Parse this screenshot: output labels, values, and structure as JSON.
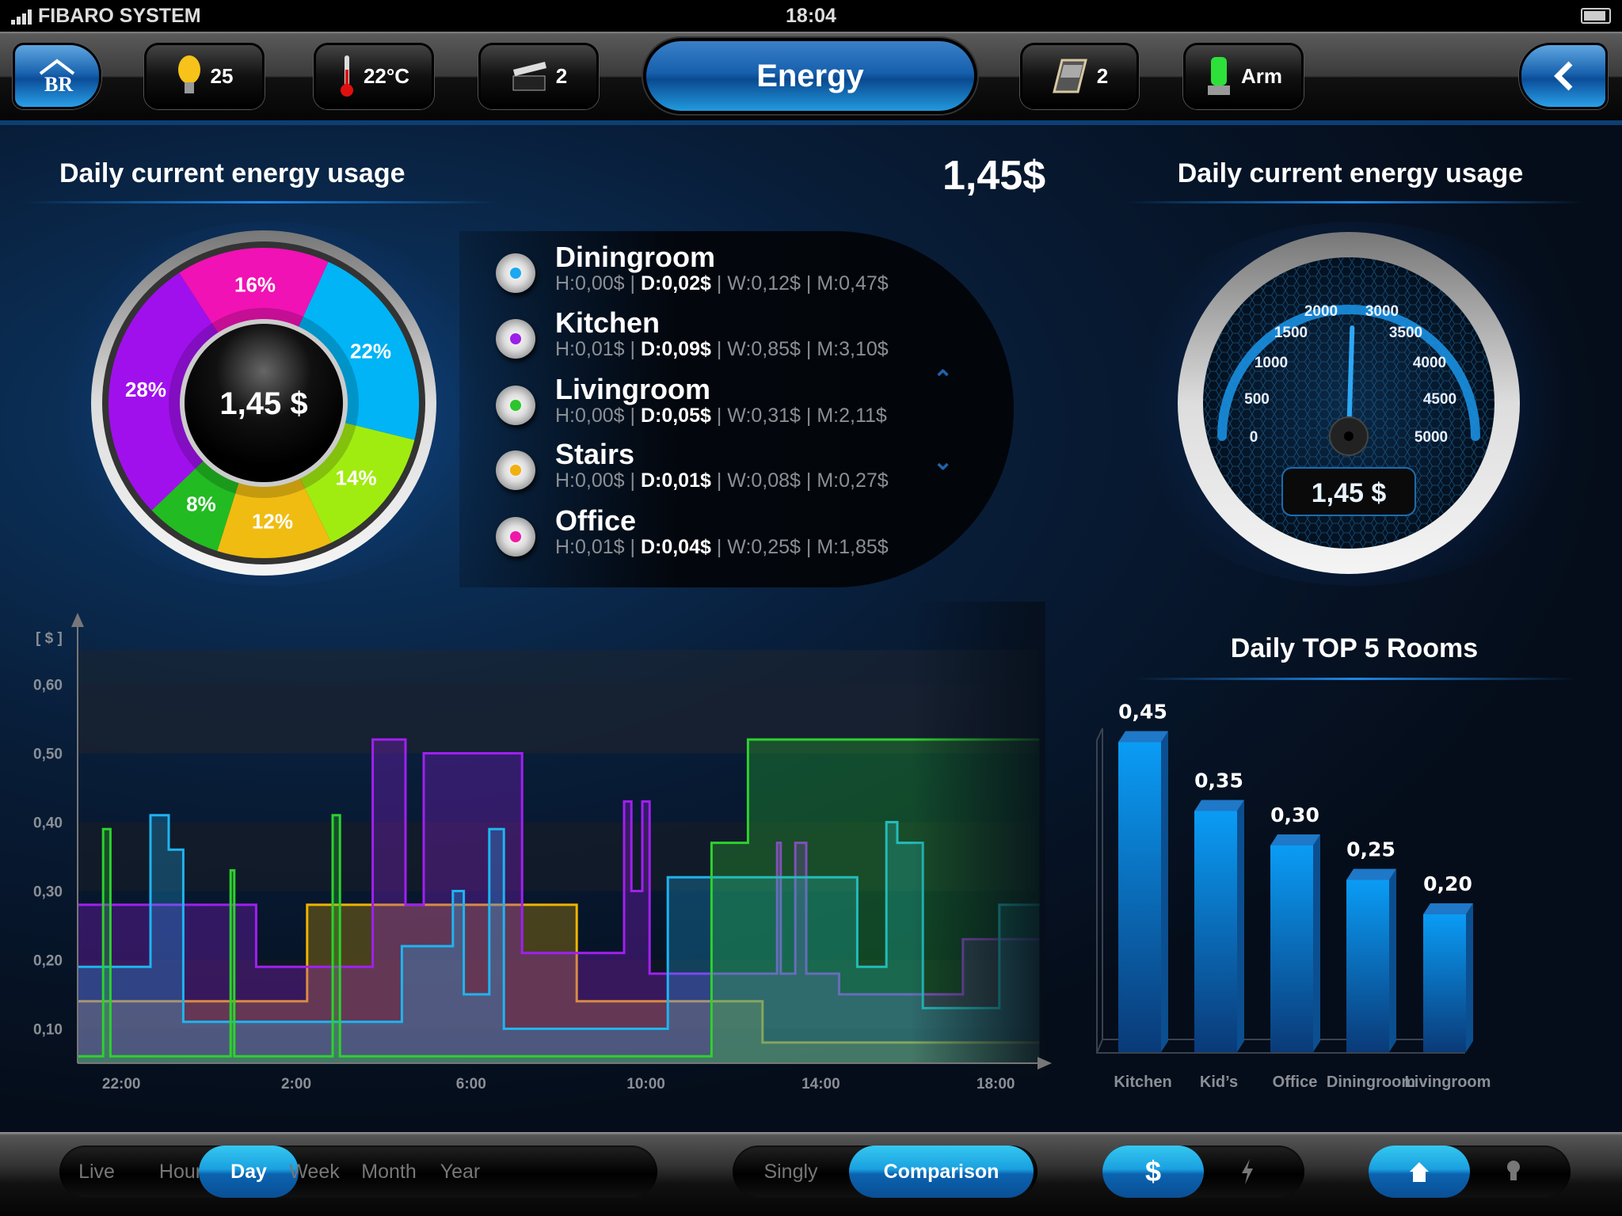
{
  "status_bar": {
    "carrier": "FIBARO SYSTEM",
    "time": "18:04",
    "battery_level": 0.9
  },
  "nav": {
    "home_icon": "home-br-icon",
    "lights": {
      "icon": "lightbulb-icon",
      "value": "25"
    },
    "temperature": {
      "icon": "thermometer-icon",
      "value": "22°C"
    },
    "scenes": {
      "icon": "clapperboard-icon",
      "value": "2"
    },
    "title": "Energy",
    "blinds": {
      "icon": "window-blind-icon",
      "value": "2"
    },
    "alarm": {
      "icon": "alarm-siren-icon",
      "value": "Arm"
    },
    "back_icon": "chevron-left-icon"
  },
  "left_panel": {
    "title": "Daily current energy usage",
    "total": "1,45$",
    "donut_center": "1,45 $"
  },
  "right_panel": {
    "title": "Daily current energy usage",
    "gauge_readout": "1,45 $"
  },
  "donut": {
    "slices": [
      {
        "label": "16%",
        "value": 16,
        "color": "#f012b4"
      },
      {
        "label": "22%",
        "value": 22,
        "color": "#00b4f5"
      },
      {
        "label": "14%",
        "value": 14,
        "color": "#a0ec10"
      },
      {
        "label": "12%",
        "value": 12,
        "color": "#f0bc12"
      },
      {
        "label": "8%",
        "value": 8,
        "color": "#22bb22"
      },
      {
        "label": "28%",
        "value": 28,
        "color": "#a010ec"
      }
    ]
  },
  "rooms": [
    {
      "name": "Diningroom",
      "color": "#1aa8f0",
      "h": "H:0,00$",
      "d": "D:0,02$",
      "w": "W:0,12$",
      "m": "M:0,47$"
    },
    {
      "name": "Kitchen",
      "color": "#9b20e8",
      "h": "H:0,01$",
      "d": "D:0,09$",
      "w": "W:0,85$",
      "m": "M:3,10$"
    },
    {
      "name": "Livingroom",
      "color": "#2cc52c",
      "h": "H:0,00$",
      "d": "D:0,05$",
      "w": "W:0,31$",
      "m": "M:2,11$"
    },
    {
      "name": "Stairs",
      "color": "#f0b010",
      "h": "H:0,00$",
      "d": "D:0,01$",
      "w": "W:0,08$",
      "m": "M:0,27$"
    },
    {
      "name": "Office",
      "color": "#f018a8",
      "h": "H:0,01$",
      "d": "D:0,04$",
      "w": "W:0,25$",
      "m": "M:1,85$"
    }
  ],
  "list_scroll": {
    "up_icon": "chevron-up-icon",
    "down_icon": "chevron-down-icon"
  },
  "gauge": {
    "ticks": [
      "0",
      "500",
      "1000",
      "1500",
      "2000",
      "3000",
      "3500",
      "4000",
      "4500",
      "5000"
    ],
    "needle_value": 2550,
    "range": [
      0,
      5000
    ]
  },
  "chart_data": [
    {
      "type": "line",
      "step": true,
      "ylabel": "[ $ ]",
      "ylim": [
        0.05,
        0.65
      ],
      "xlim": [
        "21:00",
        "19:00"
      ],
      "yticks": [
        "0,10",
        "0,20",
        "0,30",
        "0,40",
        "0,50",
        "0,60"
      ],
      "ytick_values": [
        0.1,
        0.2,
        0.3,
        0.4,
        0.5,
        0.6
      ],
      "xticks": [
        "22:00",
        "2:00",
        "6:00",
        "10:00",
        "14:00",
        "18:00"
      ],
      "series": [
        {
          "color": "#f0b400",
          "points": [
            [
              "21:00",
              0.14
            ],
            [
              "02:15",
              0.28
            ],
            [
              "08:25",
              0.14
            ],
            [
              "12:40",
              0.08
            ]
          ]
        },
        {
          "color": "#a020f0",
          "points": [
            [
              "21:00",
              0.28
            ],
            [
              "01:05",
              0.19
            ],
            [
              "03:45",
              0.52
            ],
            [
              "04:30",
              0.28
            ],
            [
              "04:55",
              0.5
            ],
            [
              "07:10",
              0.21
            ],
            [
              "09:30",
              0.43
            ],
            [
              "09:40",
              0.3
            ],
            [
              "09:55",
              0.43
            ],
            [
              "10:05",
              0.18
            ],
            [
              "13:00",
              0.37
            ],
            [
              "13:05",
              0.18
            ],
            [
              "13:25",
              0.37
            ],
            [
              "13:40",
              0.18
            ],
            [
              "14:25",
              0.15
            ],
            [
              "17:15",
              0.23
            ]
          ]
        },
        {
          "color": "#1fb4f0",
          "points": [
            [
              "21:00",
              0.19
            ],
            [
              "22:40",
              0.41
            ],
            [
              "23:05",
              0.36
            ],
            [
              "23:25",
              0.11
            ],
            [
              "04:25",
              0.22
            ],
            [
              "05:35",
              0.3
            ],
            [
              "05:50",
              0.15
            ],
            [
              "06:25",
              0.39
            ],
            [
              "06:45",
              0.1
            ],
            [
              "10:30",
              0.32
            ],
            [
              "14:50",
              0.19
            ],
            [
              "15:30",
              0.4
            ],
            [
              "15:45",
              0.37
            ],
            [
              "16:20",
              0.13
            ],
            [
              "18:05",
              0.28
            ]
          ]
        },
        {
          "color": "#2ed12e",
          "points": [
            [
              "21:00",
              0.06
            ],
            [
              "21:35",
              0.39
            ],
            [
              "21:45",
              0.06
            ],
            [
              "00:30",
              0.33
            ],
            [
              "00:35",
              0.06
            ],
            [
              "02:50",
              0.41
            ],
            [
              "03:00",
              0.06
            ],
            [
              "11:30",
              0.37
            ],
            [
              "12:20",
              0.52
            ]
          ]
        }
      ],
      "grid": "horizontal bands"
    },
    {
      "type": "bar",
      "title": "Daily TOP 5 Rooms",
      "categories": [
        "Kitchen",
        "Kid’s",
        "Office",
        "Diningroom",
        "Livingroom"
      ],
      "values": [
        0.45,
        0.35,
        0.3,
        0.25,
        0.2
      ],
      "value_labels": [
        "0,45",
        "0,35",
        "0,30",
        "0,25",
        "0,20"
      ],
      "color": "#0a9cf5"
    }
  ],
  "bottom_bar": {
    "periods": [
      {
        "label": "Live"
      },
      {
        "label": "Hour"
      },
      {
        "label": "Day",
        "active": true
      },
      {
        "label": "Week"
      },
      {
        "label": "Month"
      },
      {
        "label": "Year"
      }
    ],
    "modes": [
      {
        "label": "Singly"
      },
      {
        "label": "Comparison",
        "active": true
      }
    ],
    "units": [
      {
        "label": "$",
        "active": true
      },
      {
        "icon": "lightning-icon"
      }
    ],
    "views": [
      {
        "icon": "home-icon",
        "active": true
      },
      {
        "icon": "lightbulb-icon"
      }
    ]
  }
}
